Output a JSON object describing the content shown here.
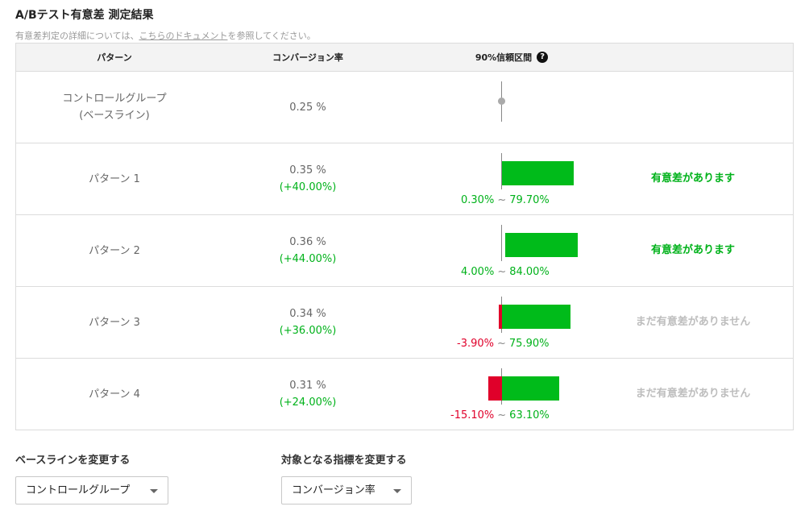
{
  "header": {
    "title": "A/Bテスト有意差 測定結果",
    "subtitle_before": "有意差判定の詳細については、",
    "subtitle_link": "こちらのドキュメント",
    "subtitle_after": "を参照してください。"
  },
  "table": {
    "columns": {
      "pattern": "パターン",
      "cvr": "コンバージョン率",
      "ci": "90%信頼区間",
      "help_icon": "question-circle-icon",
      "help_glyph": "?"
    },
    "rows": [
      {
        "name_line1": "コントロールグループ",
        "name_line2": "(ベースライン)",
        "cvr": "0.25 %",
        "lift": "",
        "ci_low_label": "",
        "ci_high_label": "",
        "ci_low": null,
        "ci_high": null,
        "verdict": ""
      },
      {
        "name_line1": "パターン 1",
        "name_line2": "",
        "cvr": "0.35 %",
        "lift": "(+40.00%)",
        "ci_low_label": "0.30%",
        "ci_high_label": "79.70%",
        "ci_low": 0.3,
        "ci_high": 79.7,
        "verdict": "有意差があります",
        "significant": true
      },
      {
        "name_line1": "パターン 2",
        "name_line2": "",
        "cvr": "0.36 %",
        "lift": "(+44.00%)",
        "ci_low_label": "4.00%",
        "ci_high_label": "84.00%",
        "ci_low": 4.0,
        "ci_high": 84.0,
        "verdict": "有意差があります",
        "significant": true
      },
      {
        "name_line1": "パターン 3",
        "name_line2": "",
        "cvr": "0.34 %",
        "lift": "(+36.00%)",
        "ci_low_label": "-3.90%",
        "ci_high_label": "75.90%",
        "ci_low": -3.9,
        "ci_high": 75.9,
        "verdict": "まだ有意差がありません",
        "significant": false
      },
      {
        "name_line1": "パターン 4",
        "name_line2": "",
        "cvr": "0.31 %",
        "lift": "(+24.00%)",
        "ci_low_label": "-15.10%",
        "ci_high_label": "63.10%",
        "ci_low": -15.1,
        "ci_high": 63.1,
        "verdict": "まだ有意差がありません",
        "significant": false
      }
    ],
    "ci_tilde": "~"
  },
  "controls": {
    "baseline_label": "ベースラインを変更する",
    "baseline_value": "コントロールグループ",
    "metric_label": "対象となる指標を変更する",
    "metric_value": "コンバージョン率"
  },
  "colors": {
    "positive": "#00bb1a",
    "negative": "#e0002a",
    "muted": "#bdbdbd"
  }
}
